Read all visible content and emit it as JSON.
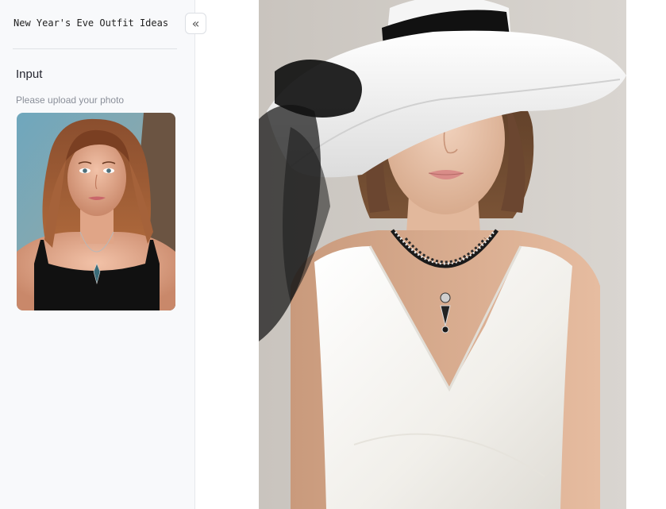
{
  "sidebar": {
    "title": "New Year's Eve Outfit Ideas",
    "collapse_icon": "chevrons-left-icon",
    "collapse_glyph": "«",
    "input_section": {
      "heading": "Input",
      "hint": "Please upload your photo"
    }
  },
  "images": {
    "input_photo": "portrait-woman-black-top-pendant-necklace",
    "output_photo": "portrait-woman-white-hat-white-dress-necklace"
  }
}
